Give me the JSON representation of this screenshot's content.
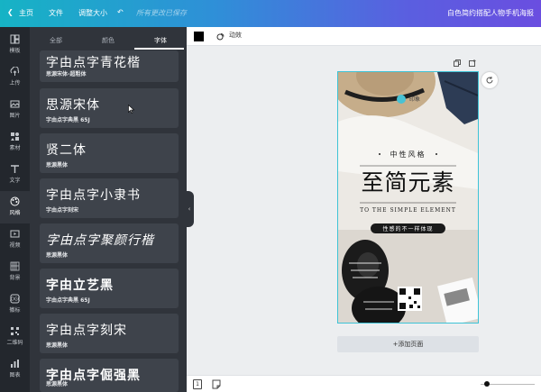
{
  "topbar": {
    "home": "主页",
    "file": "文件",
    "resize": "调整大小",
    "save_hint": "所有更改已保存",
    "doc_title": "白色简约搭配人物手机海报"
  },
  "leftnav": {
    "items": [
      {
        "label": "模板",
        "icon": "template-icon"
      },
      {
        "label": "上传",
        "icon": "upload-icon"
      },
      {
        "label": "图片",
        "icon": "image-icon"
      },
      {
        "label": "素材",
        "icon": "elements-icon"
      },
      {
        "label": "文字",
        "icon": "text-icon"
      },
      {
        "label": "风格",
        "icon": "style-icon"
      },
      {
        "label": "视频",
        "icon": "video-icon"
      },
      {
        "label": "背景",
        "icon": "background-icon"
      },
      {
        "label": "徽标",
        "icon": "logo-icon"
      },
      {
        "label": "二维码",
        "icon": "qrcode-icon"
      },
      {
        "label": "图表",
        "icon": "chart-icon"
      }
    ],
    "active_index": 5
  },
  "panel": {
    "tabs": [
      {
        "label": "全部"
      },
      {
        "label": "颜色"
      },
      {
        "label": "字体"
      }
    ],
    "active_tab": 2,
    "fonts": [
      {
        "preview": "字由点字青花楷",
        "name": "思源宋体-超粗体"
      },
      {
        "preview": "思源宋体",
        "name": "字由点字典黑 65J"
      },
      {
        "preview": "贤二体",
        "name": "思源黑体"
      },
      {
        "preview": "字由点字小隶书",
        "name": "字由点字刻宋"
      },
      {
        "preview": "字由点字聚颜行楷",
        "name": "思源黑体"
      },
      {
        "preview": "字由立艺黑",
        "name": "字由点字典黑 65J"
      },
      {
        "preview": "字由点字刻宋",
        "name": "思源黑体"
      },
      {
        "preview": "字由点字倔强黑",
        "name": "思源黑体"
      }
    ]
  },
  "toolbar": {
    "animate": "动效",
    "color": "#000000"
  },
  "poster": {
    "logo": "印象",
    "tagline": "中性风格",
    "title": "至简元素",
    "subtitle": "TO THE SIMPLE ELEMENT",
    "pill": "性感的不一样体现"
  },
  "add_page": "+添加页面",
  "bottombar": {
    "page_number": "1"
  },
  "colors": {
    "accent": "#3ec3d6",
    "panel": "#30343b",
    "nav": "#23272d"
  }
}
